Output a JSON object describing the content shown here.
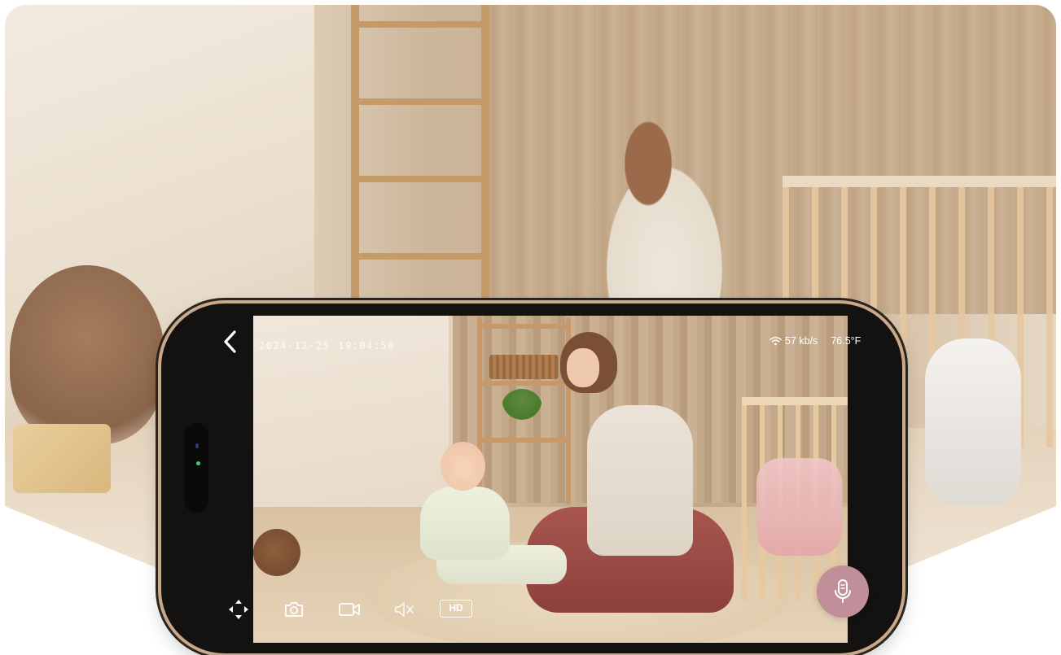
{
  "camera": {
    "date": "2024-12-25",
    "time": "19:04:50"
  },
  "status": {
    "network_speed": "57 kb/s",
    "temperature": "76.5°F"
  },
  "toolbar": {
    "quality_label": "HD"
  },
  "icons": {
    "back": "chevron-left-icon",
    "wifi": "wifi-icon",
    "fullscreen": "fullscreen-icon",
    "snapshot": "camera-icon",
    "record": "video-icon",
    "mute": "speaker-mute-icon",
    "talk": "microphone-icon"
  },
  "colors": {
    "mic_button": "#c08f9a",
    "phone_frame": "#141210",
    "overlay_text": "#ffffff"
  }
}
